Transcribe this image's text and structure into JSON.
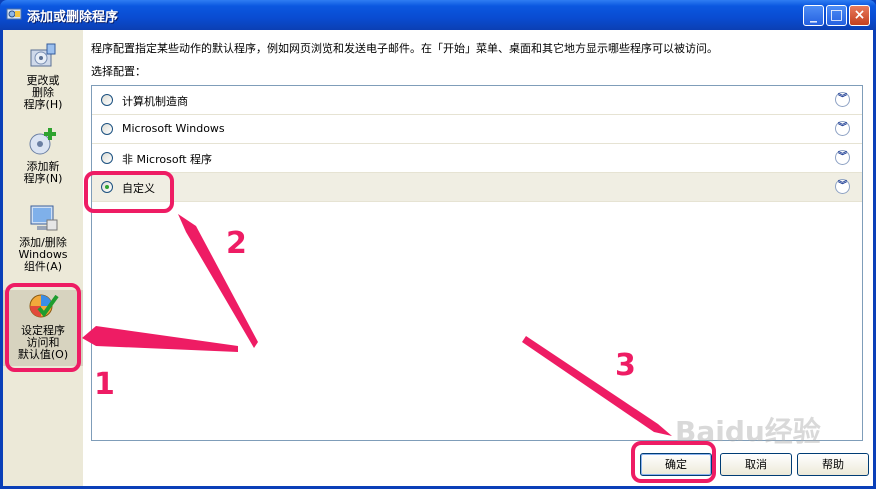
{
  "window": {
    "title": "添加或删除程序",
    "minimize": "_",
    "maximize": "□",
    "close": "×"
  },
  "sidebar": {
    "items": [
      {
        "label": "更改或删除程序(H)",
        "line1": "更改或",
        "line2": "删除",
        "line3": "程序(H)",
        "icon": "change-remove-icon"
      },
      {
        "label": "添加新程序(N)",
        "line1": "添加新",
        "line2": "程序(N)",
        "icon": "add-new-icon"
      },
      {
        "label": "添加/删除Windows组件(A)",
        "line1": "添加/删除",
        "line2": "Windows",
        "line3": "组件(A)",
        "icon": "windows-components-icon"
      },
      {
        "label": "设定程序访问和默认值(O)",
        "line1": "设定程序",
        "line2": "访问和",
        "line3": "默认值(O)",
        "icon": "set-defaults-icon"
      }
    ]
  },
  "main": {
    "description": "程序配置指定某些动作的默认程序，例如网页浏览和发送电子邮件。在「开始」菜单、桌面和其它地方显示哪些程序可以被访问。",
    "config_label": "选择配置：",
    "options": [
      {
        "label": "计算机制造商",
        "selected": false
      },
      {
        "label": "Microsoft Windows",
        "selected": false
      },
      {
        "label": "非 Microsoft 程序",
        "selected": false
      },
      {
        "label": "自定义",
        "selected": true
      }
    ]
  },
  "buttons": {
    "ok": "确定",
    "cancel": "取消",
    "help": "帮助"
  },
  "annotations": {
    "n1": "1",
    "n2": "2",
    "n3": "3",
    "color": "#ee1c64"
  },
  "watermark": "Baidu经验"
}
